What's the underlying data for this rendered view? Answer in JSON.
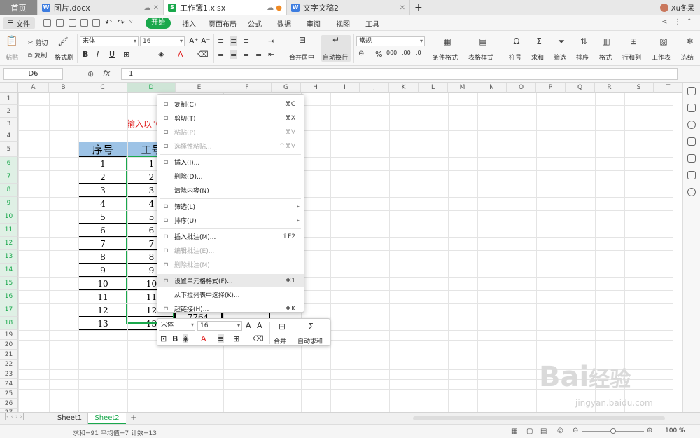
{
  "tabs": [
    {
      "label": "首页"
    },
    {
      "label": "图片.docx"
    },
    {
      "label": "工作簿1.xlsx"
    },
    {
      "label": "文字文稿2"
    }
  ],
  "user": {
    "name": "Xu冬呆"
  },
  "menubar": {
    "file": "文件",
    "start": "开始",
    "items": [
      "插入",
      "页面布局",
      "公式",
      "数据",
      "审阅",
      "视图",
      "工具"
    ]
  },
  "ribbon": {
    "paste": "粘贴",
    "cut": "剪切",
    "copy": "复制",
    "format_painter": "格式刷",
    "font_name": "宋体",
    "font_size": "16",
    "merge_center": "合并居中",
    "wrap_text": "自动换行",
    "number_format": "常规",
    "cond_format": "条件格式",
    "table_style": "表格样式",
    "symbol": "符号",
    "sum": "求和",
    "filter": "筛选",
    "sort": "排序",
    "format": "格式",
    "rows_cols": "行和列",
    "worksheet": "工作表",
    "freeze": "冻结"
  },
  "formula": {
    "cell_ref": "D6",
    "fx": "fx",
    "value": "1"
  },
  "columns": [
    "A",
    "B",
    "C",
    "D",
    "E",
    "F",
    "G",
    "H",
    "I",
    "J",
    "K",
    "L",
    "M",
    "N",
    "O",
    "P",
    "Q",
    "R",
    "S",
    "T"
  ],
  "rows": [
    "1",
    "2",
    "3",
    "4",
    "5",
    "6",
    "7",
    "8",
    "9",
    "10",
    "11",
    "12",
    "13",
    "14",
    "15",
    "16",
    "17",
    "18",
    "19",
    "20",
    "21",
    "22",
    "23",
    "24",
    "25",
    "26",
    "27"
  ],
  "sheet": {
    "note_text": "输入以\"0",
    "header_c": "序号",
    "header_d": "工号",
    "col_c": [
      "1",
      "2",
      "3",
      "4",
      "5",
      "6",
      "7",
      "8",
      "9",
      "10",
      "11",
      "12",
      "13"
    ],
    "col_d": [
      "1",
      "2",
      "3",
      "4",
      "5",
      "6",
      "7",
      "8",
      "9",
      "10",
      "11",
      "12",
      "13"
    ],
    "e18": "7764"
  },
  "context_menu": [
    {
      "label": "复制(C)",
      "shortcut": "⌘C",
      "icon": "copy-icon"
    },
    {
      "label": "剪切(T)",
      "shortcut": "⌘X",
      "icon": "scissors-icon"
    },
    {
      "label": "粘贴(P)",
      "shortcut": "⌘V",
      "icon": "paste-icon"
    },
    {
      "label": "选择性粘贴...",
      "shortcut": "^⌘V",
      "icon": "paste-special-icon"
    },
    {
      "label": "插入(I)...",
      "shortcut": "",
      "icon": "insert-icon"
    },
    {
      "label": "删除(D)...",
      "shortcut": "",
      "icon": ""
    },
    {
      "label": "清除内容(N)",
      "shortcut": "",
      "icon": ""
    },
    {
      "label": "筛选(L)",
      "shortcut": "",
      "icon": "filter-icon"
    },
    {
      "label": "排序(U)",
      "shortcut": "",
      "icon": "sort-icon"
    },
    {
      "label": "插入批注(M)...",
      "shortcut": "⇧F2",
      "icon": "comment-icon"
    },
    {
      "label": "编辑批注(E)...",
      "shortcut": "",
      "icon": "edit-comment-icon"
    },
    {
      "label": "删除批注(M)",
      "shortcut": "",
      "icon": "delete-comment-icon"
    },
    {
      "label": "设置单元格格式(F)...",
      "shortcut": "⌘1",
      "icon": "format-cells-icon"
    },
    {
      "label": "从下拉列表中选择(K)...",
      "shortcut": "",
      "icon": ""
    },
    {
      "label": "超链接(H)...",
      "shortcut": "⌘K",
      "icon": "link-icon"
    }
  ],
  "mini_toolbar": {
    "font_name": "宋体",
    "font_size": "16",
    "merge": "合并",
    "autosum": "自动求和"
  },
  "sheet_tabs": [
    "Sheet1",
    "Sheet2"
  ],
  "status": {
    "summary": "求和=91  平均值=7  计数=13",
    "zoom": "100 %"
  },
  "watermark": {
    "line1": "Bai",
    "line2": "经验",
    "url": "jingyan.baidu.com"
  },
  "colors": {
    "accent": "#1aa84c",
    "header_fill": "#9dc3e6",
    "red_text": "#e02020",
    "selection": "#1aa84c"
  }
}
